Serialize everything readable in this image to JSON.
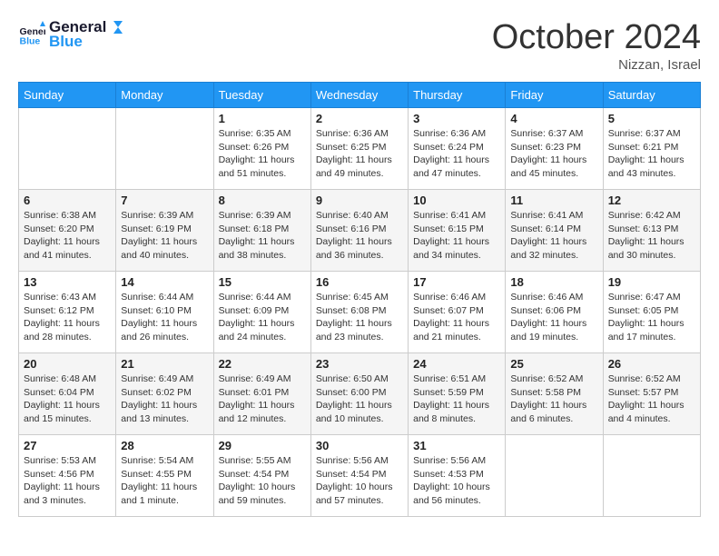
{
  "header": {
    "logo_line1": "General",
    "logo_line2": "Blue",
    "title": "October 2024",
    "location": "Nizzan, Israel"
  },
  "days_of_week": [
    "Sunday",
    "Monday",
    "Tuesday",
    "Wednesday",
    "Thursday",
    "Friday",
    "Saturday"
  ],
  "weeks": [
    [
      {
        "day": "",
        "info": ""
      },
      {
        "day": "",
        "info": ""
      },
      {
        "day": "1",
        "info": "Sunrise: 6:35 AM\nSunset: 6:26 PM\nDaylight: 11 hours and 51 minutes."
      },
      {
        "day": "2",
        "info": "Sunrise: 6:36 AM\nSunset: 6:25 PM\nDaylight: 11 hours and 49 minutes."
      },
      {
        "day": "3",
        "info": "Sunrise: 6:36 AM\nSunset: 6:24 PM\nDaylight: 11 hours and 47 minutes."
      },
      {
        "day": "4",
        "info": "Sunrise: 6:37 AM\nSunset: 6:23 PM\nDaylight: 11 hours and 45 minutes."
      },
      {
        "day": "5",
        "info": "Sunrise: 6:37 AM\nSunset: 6:21 PM\nDaylight: 11 hours and 43 minutes."
      }
    ],
    [
      {
        "day": "6",
        "info": "Sunrise: 6:38 AM\nSunset: 6:20 PM\nDaylight: 11 hours and 41 minutes."
      },
      {
        "day": "7",
        "info": "Sunrise: 6:39 AM\nSunset: 6:19 PM\nDaylight: 11 hours and 40 minutes."
      },
      {
        "day": "8",
        "info": "Sunrise: 6:39 AM\nSunset: 6:18 PM\nDaylight: 11 hours and 38 minutes."
      },
      {
        "day": "9",
        "info": "Sunrise: 6:40 AM\nSunset: 6:16 PM\nDaylight: 11 hours and 36 minutes."
      },
      {
        "day": "10",
        "info": "Sunrise: 6:41 AM\nSunset: 6:15 PM\nDaylight: 11 hours and 34 minutes."
      },
      {
        "day": "11",
        "info": "Sunrise: 6:41 AM\nSunset: 6:14 PM\nDaylight: 11 hours and 32 minutes."
      },
      {
        "day": "12",
        "info": "Sunrise: 6:42 AM\nSunset: 6:13 PM\nDaylight: 11 hours and 30 minutes."
      }
    ],
    [
      {
        "day": "13",
        "info": "Sunrise: 6:43 AM\nSunset: 6:12 PM\nDaylight: 11 hours and 28 minutes."
      },
      {
        "day": "14",
        "info": "Sunrise: 6:44 AM\nSunset: 6:10 PM\nDaylight: 11 hours and 26 minutes."
      },
      {
        "day": "15",
        "info": "Sunrise: 6:44 AM\nSunset: 6:09 PM\nDaylight: 11 hours and 24 minutes."
      },
      {
        "day": "16",
        "info": "Sunrise: 6:45 AM\nSunset: 6:08 PM\nDaylight: 11 hours and 23 minutes."
      },
      {
        "day": "17",
        "info": "Sunrise: 6:46 AM\nSunset: 6:07 PM\nDaylight: 11 hours and 21 minutes."
      },
      {
        "day": "18",
        "info": "Sunrise: 6:46 AM\nSunset: 6:06 PM\nDaylight: 11 hours and 19 minutes."
      },
      {
        "day": "19",
        "info": "Sunrise: 6:47 AM\nSunset: 6:05 PM\nDaylight: 11 hours and 17 minutes."
      }
    ],
    [
      {
        "day": "20",
        "info": "Sunrise: 6:48 AM\nSunset: 6:04 PM\nDaylight: 11 hours and 15 minutes."
      },
      {
        "day": "21",
        "info": "Sunrise: 6:49 AM\nSunset: 6:02 PM\nDaylight: 11 hours and 13 minutes."
      },
      {
        "day": "22",
        "info": "Sunrise: 6:49 AM\nSunset: 6:01 PM\nDaylight: 11 hours and 12 minutes."
      },
      {
        "day": "23",
        "info": "Sunrise: 6:50 AM\nSunset: 6:00 PM\nDaylight: 11 hours and 10 minutes."
      },
      {
        "day": "24",
        "info": "Sunrise: 6:51 AM\nSunset: 5:59 PM\nDaylight: 11 hours and 8 minutes."
      },
      {
        "day": "25",
        "info": "Sunrise: 6:52 AM\nSunset: 5:58 PM\nDaylight: 11 hours and 6 minutes."
      },
      {
        "day": "26",
        "info": "Sunrise: 6:52 AM\nSunset: 5:57 PM\nDaylight: 11 hours and 4 minutes."
      }
    ],
    [
      {
        "day": "27",
        "info": "Sunrise: 5:53 AM\nSunset: 4:56 PM\nDaylight: 11 hours and 3 minutes."
      },
      {
        "day": "28",
        "info": "Sunrise: 5:54 AM\nSunset: 4:55 PM\nDaylight: 11 hours and 1 minute."
      },
      {
        "day": "29",
        "info": "Sunrise: 5:55 AM\nSunset: 4:54 PM\nDaylight: 10 hours and 59 minutes."
      },
      {
        "day": "30",
        "info": "Sunrise: 5:56 AM\nSunset: 4:54 PM\nDaylight: 10 hours and 57 minutes."
      },
      {
        "day": "31",
        "info": "Sunrise: 5:56 AM\nSunset: 4:53 PM\nDaylight: 10 hours and 56 minutes."
      },
      {
        "day": "",
        "info": ""
      },
      {
        "day": "",
        "info": ""
      }
    ]
  ]
}
